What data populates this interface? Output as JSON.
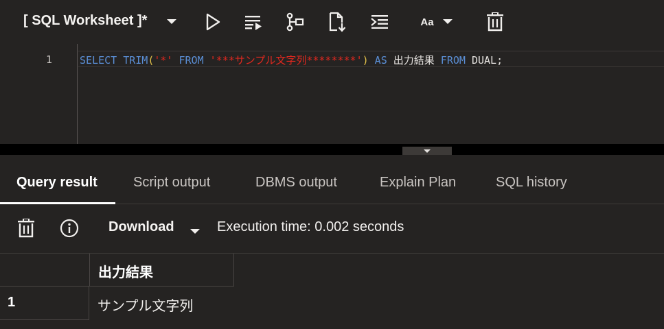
{
  "toolbar": {
    "worksheet_title": "[ SQL Worksheet ]*",
    "icons": [
      "chevron-down-icon",
      "run-statement-icon",
      "run-script-icon",
      "explain-plan-icon",
      "autotrace-icon",
      "format-icon",
      "font-case-icon",
      "clear-icon"
    ],
    "font_case_label": "Aa"
  },
  "editor": {
    "line_number": "1",
    "code_tokens": {
      "t1": "SELECT TRIM",
      "t2": "(",
      "t3": "'*'",
      "t4": " FROM ",
      "t5": "'***サンプル文字列********'",
      "t6": ")",
      "t7": " AS ",
      "t8": "出力結果",
      "t9": " FROM ",
      "t10": "DUAL;"
    }
  },
  "tabs": [
    {
      "label": "Query result",
      "active": true
    },
    {
      "label": "Script output",
      "active": false
    },
    {
      "label": "DBMS output",
      "active": false
    },
    {
      "label": "Explain Plan",
      "active": false
    },
    {
      "label": "SQL history",
      "active": false
    }
  ],
  "result_toolbar": {
    "download_label": "Download",
    "execution_time": "Execution time: 0.002 seconds"
  },
  "grid": {
    "columns": [
      "出力結果"
    ],
    "rows": [
      {
        "row_number": "1",
        "values": [
          "サンプル文字列"
        ]
      }
    ]
  },
  "colors": {
    "background": "#252322",
    "keyword": "#5b8fd6",
    "string": "#e0281f",
    "paren": "#e3c24a"
  }
}
